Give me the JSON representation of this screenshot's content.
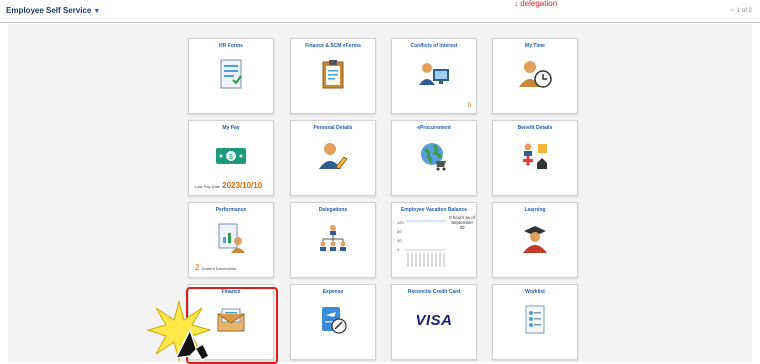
{
  "header": {
    "title": "Employee Self Service",
    "pager": "1 of 2",
    "annotation": "delegation"
  },
  "tiles": [
    {
      "title": "HR Forms",
      "icon": "document-form-icon"
    },
    {
      "title": "Finance & SCM eForms",
      "icon": "clipboard-icon"
    },
    {
      "title": "Conflicts of Interest",
      "icon": "person-computer-icon",
      "badge": "0"
    },
    {
      "title": "My Time",
      "icon": "person-clock-icon"
    },
    {
      "title": "My Pay",
      "icon": "cash-icon",
      "foot_label": "Last Pay Date",
      "foot_value": "2023/10/10"
    },
    {
      "title": "Personal Details",
      "icon": "person-pencil-icon"
    },
    {
      "title": "eProcurement",
      "icon": "globe-cart-icon"
    },
    {
      "title": "Benefit Details",
      "icon": "benefits-icon"
    },
    {
      "title": "Performance",
      "icon": "document-chart-icon",
      "foot_count": "2",
      "foot_label": "Current Documents"
    },
    {
      "title": "Delegations",
      "icon": "org-chart-icon"
    },
    {
      "title": "Employee Vacation Balance",
      "icon": "bar-chart-icon",
      "chart_label": "0 hours as of September 30",
      "chart_ticks": [
        "120",
        "80",
        "40",
        "0"
      ]
    },
    {
      "title": "Learning",
      "icon": "graduate-icon"
    },
    {
      "title": "Finance",
      "icon": "envelope-icon"
    },
    {
      "title": "Expense",
      "icon": "travel-expense-icon"
    },
    {
      "title": "Reconcile Credit Card",
      "icon": "visa-logo",
      "logo_text": "VISA"
    },
    {
      "title": "Worklist",
      "icon": "worklist-icon"
    }
  ],
  "colors": {
    "title_blue": "#1f5fae",
    "accent_orange": "#d86a00",
    "highlight_red": "#e01b1b"
  }
}
